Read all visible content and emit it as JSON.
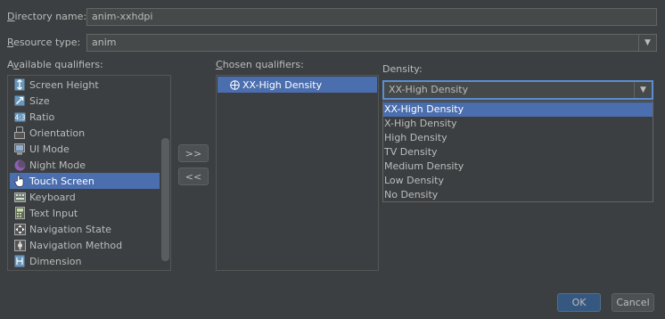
{
  "directory": {
    "label_mnemonic": "D",
    "label_rest": "irectory name:",
    "value": "anim-xxhdpi"
  },
  "resource_type": {
    "label_mnemonic": "R",
    "label_rest": "esource type:",
    "value": "anim"
  },
  "available": {
    "label_pre": "A",
    "label_mnemonic": "v",
    "label_rest": "ailable qualifiers:",
    "items": [
      {
        "label": "Screen Height",
        "icon": "screen-height-icon"
      },
      {
        "label": "Size",
        "icon": "size-icon"
      },
      {
        "label": "Ratio",
        "icon": "ratio-icon"
      },
      {
        "label": "Orientation",
        "icon": "orientation-icon"
      },
      {
        "label": "UI Mode",
        "icon": "ui-mode-icon"
      },
      {
        "label": "Night Mode",
        "icon": "night-mode-icon"
      },
      {
        "label": "Touch Screen",
        "icon": "touch-screen-icon",
        "selected": true
      },
      {
        "label": "Keyboard",
        "icon": "keyboard-icon"
      },
      {
        "label": "Text Input",
        "icon": "text-input-icon"
      },
      {
        "label": "Navigation State",
        "icon": "navigation-state-icon"
      },
      {
        "label": "Navigation Method",
        "icon": "navigation-method-icon"
      },
      {
        "label": "Dimension",
        "icon": "dimension-icon"
      }
    ]
  },
  "buttons": {
    "add": ">>",
    "remove": "<<",
    "ok": "OK",
    "cancel": "Cancel"
  },
  "chosen": {
    "label_mnemonic": "C",
    "label_rest": "hosen qualifiers:",
    "items": [
      {
        "label": "XX-High Density",
        "icon": "density-icon",
        "selected": true
      }
    ]
  },
  "density": {
    "label": "Density:",
    "value": "XX-High Density",
    "options": [
      {
        "label": "XX-High Density",
        "selected": true
      },
      {
        "label": "X-High Density"
      },
      {
        "label": "High Density"
      },
      {
        "label": "TV Density"
      },
      {
        "label": "Medium Density"
      },
      {
        "label": "Low Density"
      },
      {
        "label": "No Density"
      }
    ]
  },
  "colors": {
    "background": "#3c3f41",
    "selection": "#4b6eaf",
    "primary_button": "#365880"
  }
}
